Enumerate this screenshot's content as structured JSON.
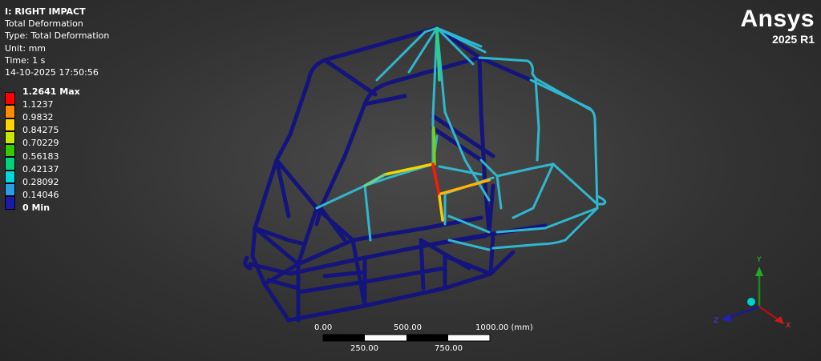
{
  "info": {
    "title": "I: RIGHT IMPACT",
    "result": "Total Deformation",
    "type": "Type: Total Deformation",
    "unit": "Unit: mm",
    "time": "Time: 1 s",
    "timestamp": "14-10-2025 17:50:56"
  },
  "legend": {
    "labels": [
      "1.2641 Max",
      "1.1237",
      "0.9832",
      "0.84275",
      "0.70229",
      "0.56183",
      "0.42137",
      "0.28092",
      "0.14046",
      "0 Min"
    ],
    "colors": [
      "#ff0000",
      "#ff8c00",
      "#ffd400",
      "#c8e600",
      "#37c800",
      "#00d27d",
      "#00d8d8",
      "#2a9ee6",
      "#1a1aa8"
    ]
  },
  "brand": {
    "name": "Ansys",
    "version": "2025 R1"
  },
  "scale": {
    "top_labels": [
      "0.00",
      "500.00",
      "1000.00 (mm)"
    ],
    "bottom_labels": [
      "250.00",
      "750.00"
    ]
  },
  "triad": {
    "x": "X",
    "y": "Y",
    "z": "Z"
  },
  "colors": {
    "frame": "#13137a",
    "highlight": "#ff0000"
  }
}
